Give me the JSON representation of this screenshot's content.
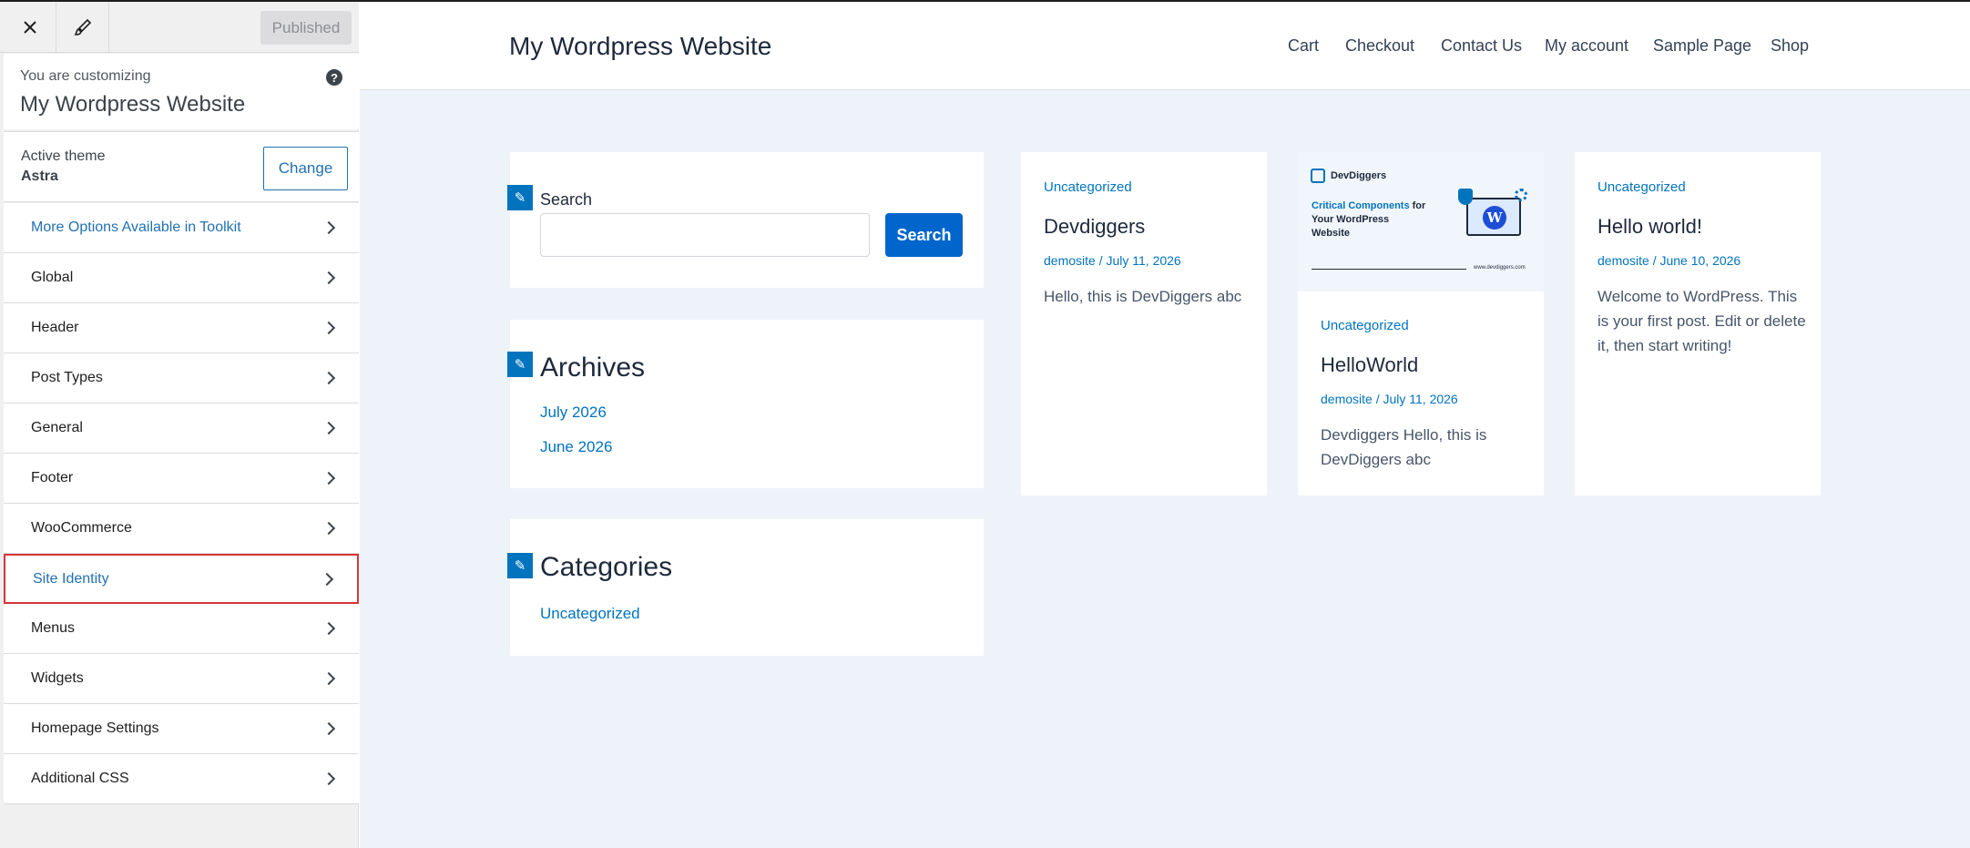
{
  "customizer": {
    "close_icon": "close-icon",
    "brush_icon": "brush-icon",
    "published_label": "Published",
    "customizing_label": "You are customizing",
    "site_title": "My Wordpress Website",
    "help_icon": "question-icon",
    "active_theme_label": "Active theme",
    "active_theme_name": "Astra",
    "change_label": "Change",
    "menu": [
      {
        "label": "More Options Available in Toolkit"
      },
      {
        "label": "Global"
      },
      {
        "label": "Header"
      },
      {
        "label": "Post Types"
      },
      {
        "label": "General"
      },
      {
        "label": "Footer"
      },
      {
        "label": "WooCommerce"
      },
      {
        "label": "Site Identity"
      },
      {
        "label": "Menus"
      },
      {
        "label": "Widgets"
      },
      {
        "label": "Homepage Settings"
      },
      {
        "label": "Additional CSS"
      }
    ],
    "colors": {
      "accent": "#2271b1",
      "highlight_border": "#d63638"
    }
  },
  "site": {
    "title": "My Wordpress Website",
    "nav": [
      {
        "label": "Cart"
      },
      {
        "label": "Checkout"
      },
      {
        "label": "Contact Us"
      },
      {
        "label": "My account"
      },
      {
        "label": "Sample Page"
      },
      {
        "label": "Shop"
      }
    ],
    "widgets": {
      "search_label": "Search",
      "search_button": "Search",
      "archives_title": "Archives",
      "archives": [
        "July 2026",
        "June 2026"
      ],
      "categories_title": "Categories",
      "categories": [
        "Uncategorized"
      ]
    },
    "posts": [
      {
        "category": "Uncategorized",
        "title": "Devdiggers",
        "meta": "demosite / July 11, 2026",
        "excerpt": "Hello, this is DevDiggers abc"
      },
      {
        "category": "Uncategorized",
        "title": "HelloWorld",
        "meta": "demosite / July 11, 2026",
        "excerpt": "Devdiggers Hello, this is DevDiggers abc",
        "thumbnail": {
          "brand": "DevDiggers",
          "headline_highlight": "Critical Components",
          "headline_rest": " for",
          "line2": "Your WordPress",
          "line3": "Website",
          "url": "www.devdiggers.com"
        }
      },
      {
        "category": "Uncategorized",
        "title": "Hello world!",
        "meta": "demosite / June 10, 2026",
        "excerpt": "Welcome to WordPress. This is your first post. Edit or delete it, then start writing!"
      }
    ],
    "colors": {
      "link": "#0274be",
      "button": "#0066cc",
      "background": "#eef3f9"
    }
  }
}
